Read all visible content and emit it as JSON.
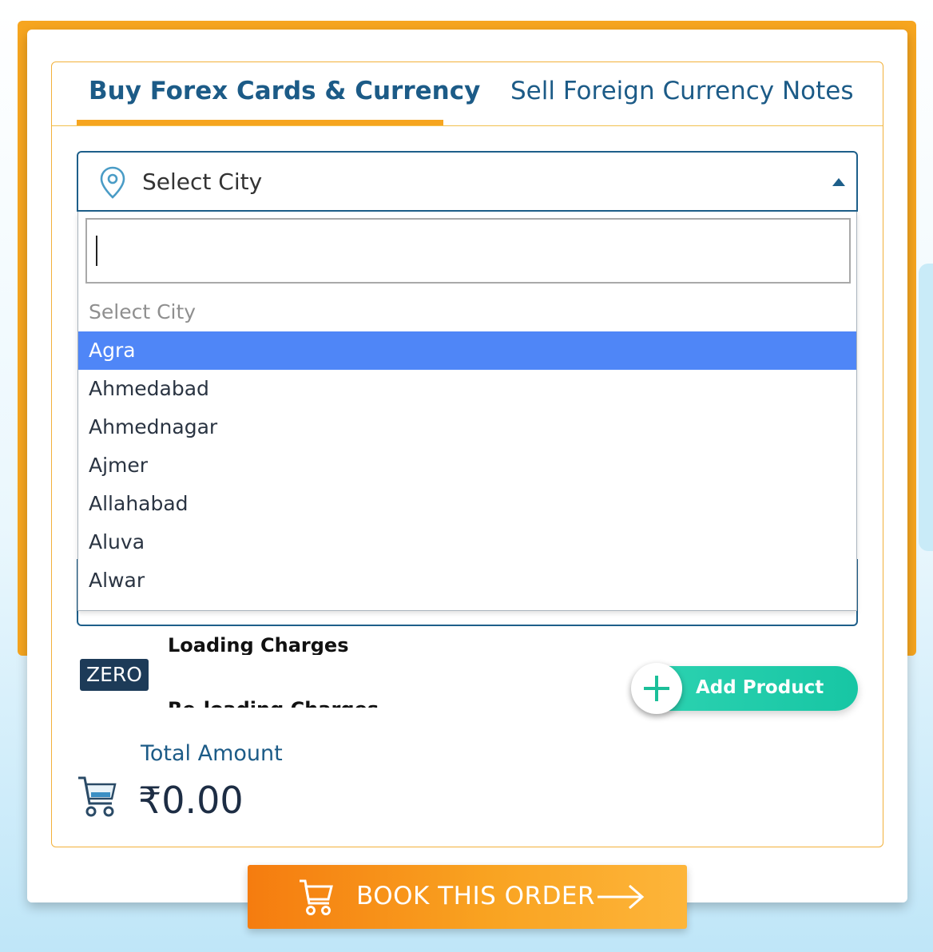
{
  "tabs": {
    "buy_label": "Buy Forex Cards & Currency",
    "sell_label": "Sell Foreign Currency Notes"
  },
  "city_select": {
    "selected_text": "Select City",
    "icon": "map-pin-icon",
    "search_value": "",
    "options": [
      {
        "label": "Select City",
        "state": "placeholder"
      },
      {
        "label": "Agra",
        "state": "highlighted"
      },
      {
        "label": "Ahmedabad",
        "state": "normal"
      },
      {
        "label": "Ahmednagar",
        "state": "normal"
      },
      {
        "label": "Ajmer",
        "state": "normal"
      },
      {
        "label": "Allahabad",
        "state": "normal"
      },
      {
        "label": "Aluva",
        "state": "normal"
      },
      {
        "label": "Alwar",
        "state": "normal"
      }
    ]
  },
  "charges": {
    "badge": "ZERO",
    "loading_label": "Loading Charges",
    "reloading_label": "Re-loading Charges"
  },
  "add_product": {
    "label": "Add Product",
    "icon": "plus-icon"
  },
  "total": {
    "label": "Total Amount",
    "value": "₹0.00",
    "icon": "shopping-cart-icon"
  },
  "book_button": {
    "label": "BOOK THIS ORDER",
    "icon_left": "cart-icon",
    "icon_right": "arrow-right-icon"
  },
  "colors": {
    "brand_orange": "#f6a51f",
    "primary_blue": "#1c5b87",
    "highlight": "#4f86f7",
    "teal": "#17c6a4",
    "badge_navy": "#1d3b58"
  }
}
